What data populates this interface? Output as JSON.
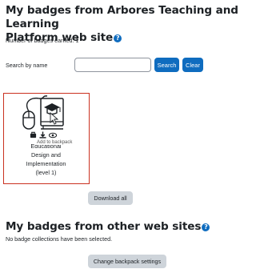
{
  "local_section": {
    "title_line1": "My badges from Arbores Teaching and Learning",
    "title_line2": "Platform web site",
    "help_icon": "question-circle-icon",
    "count_text": "Number of badges earned: 1"
  },
  "search": {
    "label": "Search by name",
    "value": "",
    "placeholder": "",
    "search_button": "Search",
    "clear_button": "Clear"
  },
  "badge": {
    "name_lines": [
      "Educational",
      "Design and",
      "Implementation",
      "(level 1)"
    ],
    "tooltip": "Add to backpack",
    "image_icon": "badge-mouse-book-icon",
    "actions": [
      "backpack-icon",
      "download-icon",
      "view-icon"
    ]
  },
  "download_all_button": "Download all",
  "external_section": {
    "title": "My badges from other web sites",
    "help_icon": "question-circle-icon",
    "empty_text": "No badge collections have been selected.",
    "change_button": "Change backpack settings"
  },
  "colors": {
    "primary": "#0f6cbf",
    "secondary_button": "#ced4da",
    "card_border": "#ca3120"
  }
}
